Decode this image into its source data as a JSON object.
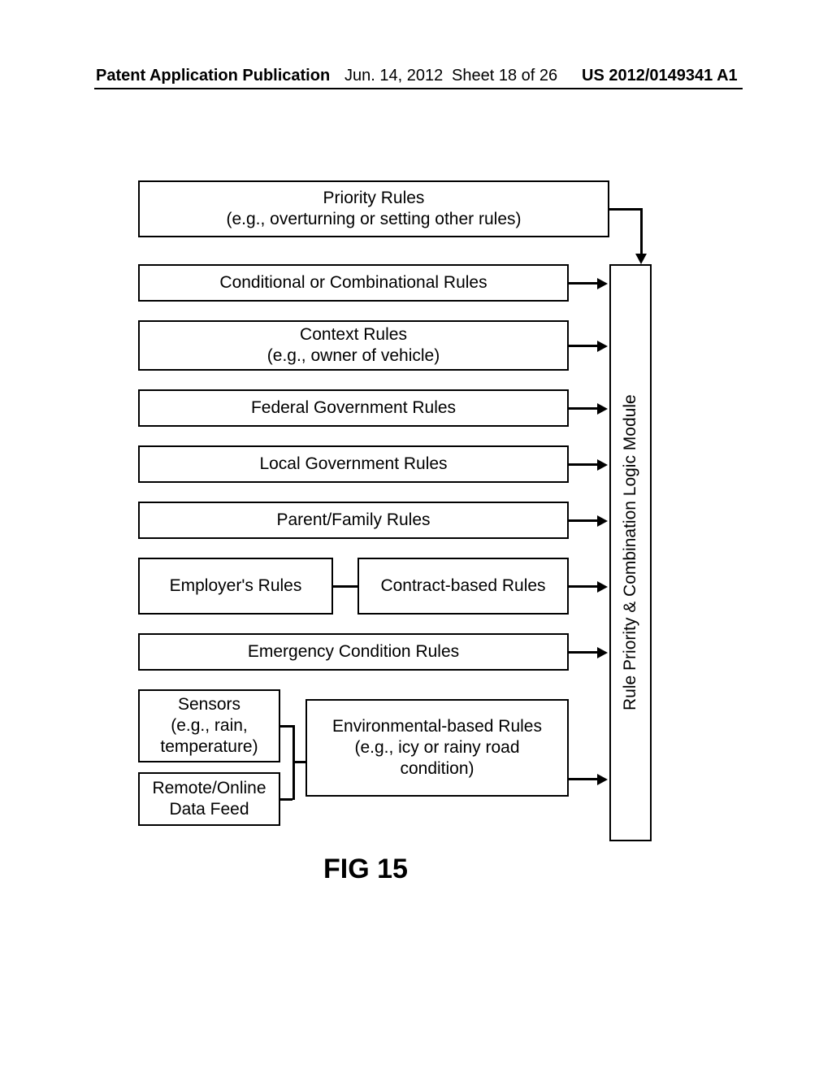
{
  "header": {
    "publication": "Patent Application Publication",
    "date": "Jun. 14, 2012",
    "sheet": "Sheet 18 of 26",
    "number": "US 2012/0149341 A1"
  },
  "boxes": {
    "priority": "Priority Rules\n(e.g., overturning or setting other rules)",
    "conditional": "Conditional or Combinational Rules",
    "context": "Context Rules\n(e.g., owner of vehicle)",
    "federal": "Federal Government Rules",
    "local": "Local Government Rules",
    "parent": "Parent/Family Rules",
    "employer": "Employer's Rules",
    "contract": "Contract-based Rules",
    "emergency": "Emergency Condition Rules",
    "sensors": "Sensors\n(e.g., rain,\ntemperature)",
    "remote": "Remote/Online\nData Feed",
    "environmental": "Environmental-based Rules\n(e.g., icy or rainy road\ncondition)"
  },
  "module": "Rule Priority & Combination Logic Module",
  "figure": "FIG 15"
}
